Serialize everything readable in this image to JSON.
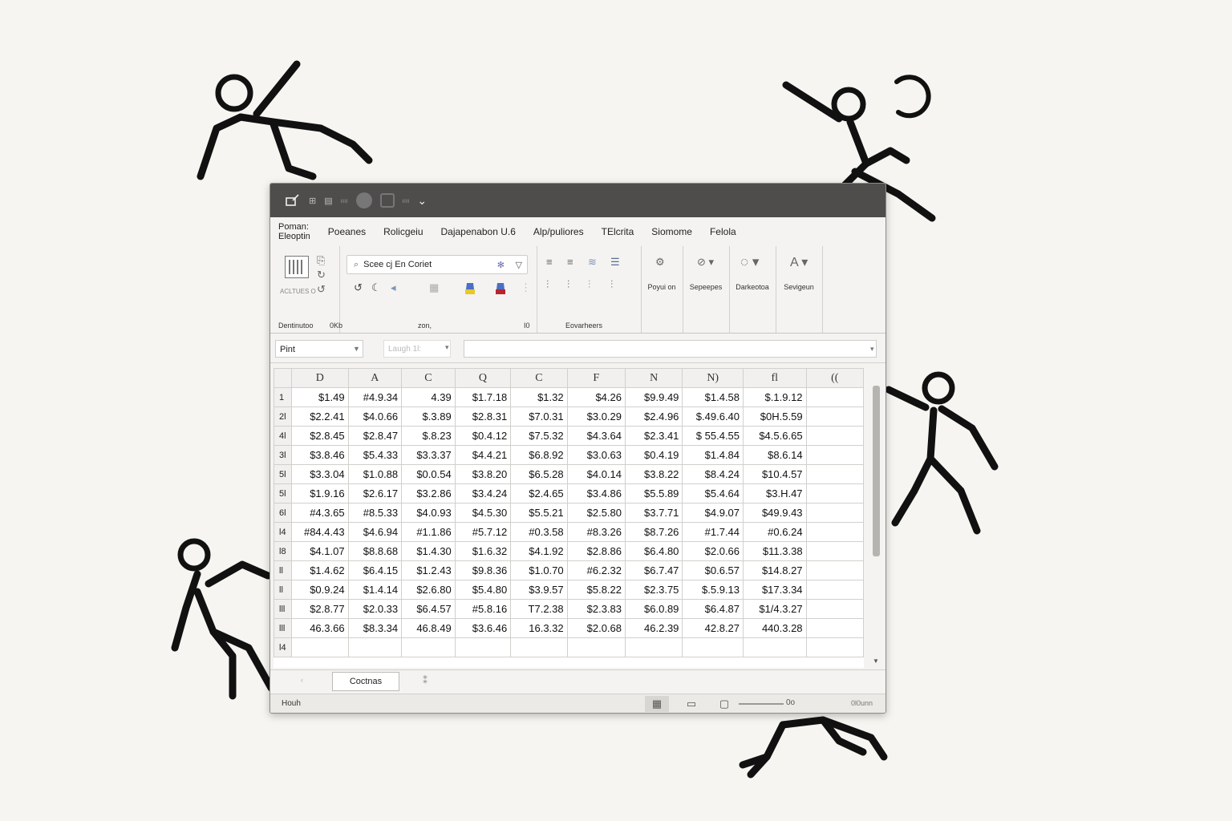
{
  "titlebar": {
    "app_icon": "edit-window-icon",
    "items": [
      "⊞",
      "▤",
      "ıııı"
    ],
    "small_text": "ıııı",
    "dropdown": "⌄"
  },
  "ribbon_tabs": {
    "first_line1": "Poman:",
    "first_line2": "Eleoptin",
    "tabs": [
      "Poeanes",
      "Rolicgeiu",
      "Dajapenabon U.6",
      "Alp/puliores",
      "TElcrita",
      "Siomome",
      "Felola"
    ]
  },
  "ribbon": {
    "group1_label": "Dentinutoo",
    "group1_sub": "0Kb",
    "group1_small": "ACLTUES O",
    "search_text": "Scee cj En Coriet",
    "group2_label": "zon,",
    "group2_right": "I0",
    "group3_label": "Eovarheers",
    "buttons": [
      {
        "label": "Poyui on",
        "icon": "settings-icon"
      },
      {
        "label": "Sepeepes",
        "icon": "link-icon"
      },
      {
        "label": "Darkeotoa",
        "icon": "refresh-icon"
      },
      {
        "label": "Sevigeun",
        "icon": "text-style-icon"
      }
    ]
  },
  "formula": {
    "name_box": "Pint",
    "fx_box": "Laugh 1l:",
    "bar_value": ""
  },
  "sheet": {
    "columns": [
      "D",
      "A",
      "C",
      "Q",
      "C",
      "F",
      "N",
      "N)",
      "fl",
      "(("
    ],
    "rows": [
      {
        "label": "1",
        "cells": [
          "$1.49",
          "#4.9.34",
          "4.39",
          "$1.7.18",
          "$1.32",
          "$4.26",
          "$9.9.49",
          "$1.4.58",
          "$.1.9.12"
        ]
      },
      {
        "label": "2l",
        "cells": [
          "$2.2.41",
          "$4.0.66",
          "$.3.89",
          "$2.8.31",
          "$7.0.31",
          "$3.0.29",
          "$2.4.96",
          "$.49.6.40",
          "$0H.5.59"
        ]
      },
      {
        "label": "4l",
        "cells": [
          "$2.8.45",
          "$2.8.47",
          "$.8.23",
          "$0.4.12",
          "$7.5.32",
          "$4.3.64",
          "$2.3.41",
          "$ 55.4.55",
          "$4.5.6.65"
        ]
      },
      {
        "label": "3l",
        "cells": [
          "$3.8.46",
          "$5.4.33",
          "$3.3.37",
          "$4.4.21",
          "$6.8.92",
          "$3.0.63",
          "$0.4.19",
          "$1.4.84",
          "$8.6.14"
        ]
      },
      {
        "label": "5l",
        "cells": [
          "$3.3.04",
          "$1.0.88",
          "$0.0.54",
          "$3.8.20",
          "$6.5.28",
          "$4.0.14",
          "$3.8.22",
          "$8.4.24",
          "$10.4.57"
        ]
      },
      {
        "label": "5l",
        "cells": [
          "$1.9.16",
          "$2.6.17",
          "$3.2.86",
          "$3.4.24",
          "$2.4.65",
          "$3.4.86",
          "$5.5.89",
          "$5.4.64",
          "$3.H.47"
        ]
      },
      {
        "label": "6l",
        "cells": [
          "#4.3.65",
          "#8.5.33",
          "$4.0.93",
          "$4.5.30",
          "$5.5.21",
          "$2.5.80",
          "$3.7.71",
          "$4.9.07",
          "$49.9.43"
        ]
      },
      {
        "label": "l4",
        "cells": [
          "#84.4.43",
          "$4.6.94",
          "#1.1.86",
          "#5.7.12",
          "#0.3.58",
          "#8.3.26",
          "$8.7.26",
          "#1.7.44",
          "#0.6.24"
        ]
      },
      {
        "label": "l8",
        "cells": [
          "$4.1.07",
          "$8.8.68",
          "$1.4.30",
          "$1.6.32",
          "$4.1.92",
          "$2.8.86",
          "$6.4.80",
          "$2.0.66",
          "$11.3.38"
        ]
      },
      {
        "label": "ll",
        "cells": [
          "$1.4.62",
          "$6.4.15",
          "$1.2.43",
          "$9.8.36",
          "$1.0.70",
          "#6.2.32",
          "$6.7.47",
          "$0.6.57",
          "$14.8.27"
        ]
      },
      {
        "label": "ll",
        "cells": [
          "$0.9.24",
          "$1.4.14",
          "$2.6.80",
          "$5.4.80",
          "$3.9.57",
          "$5.8.22",
          "$2.3.75",
          "$.5.9.13",
          "$17.3.34"
        ]
      },
      {
        "label": "lll",
        "cells": [
          "$2.8.77",
          "$2.0.33",
          "$6.4.57",
          "#5.8.16",
          "T7.2.38",
          "$2.3.83",
          "$6.0.89",
          "$6.4.87",
          "$1/4.3.27"
        ]
      },
      {
        "label": "lll",
        "cells": [
          "46.3.66",
          "$8.3.34",
          "46.8.49",
          "$3.6.46",
          "16.3.32",
          "$2.0.68",
          "46.2.39",
          "42.8.27",
          "440.3.28"
        ]
      },
      {
        "label": "l4",
        "cells": [
          "",
          "",
          "",
          "",
          "",
          "",
          "",
          "",
          ""
        ]
      }
    ]
  },
  "sheetbar": {
    "tab": "Coctnas",
    "add": "⁑",
    "nav": "‹"
  },
  "statusbar": {
    "left": "Houh",
    "right": "0l0unn",
    "zoom_label": "0o"
  }
}
